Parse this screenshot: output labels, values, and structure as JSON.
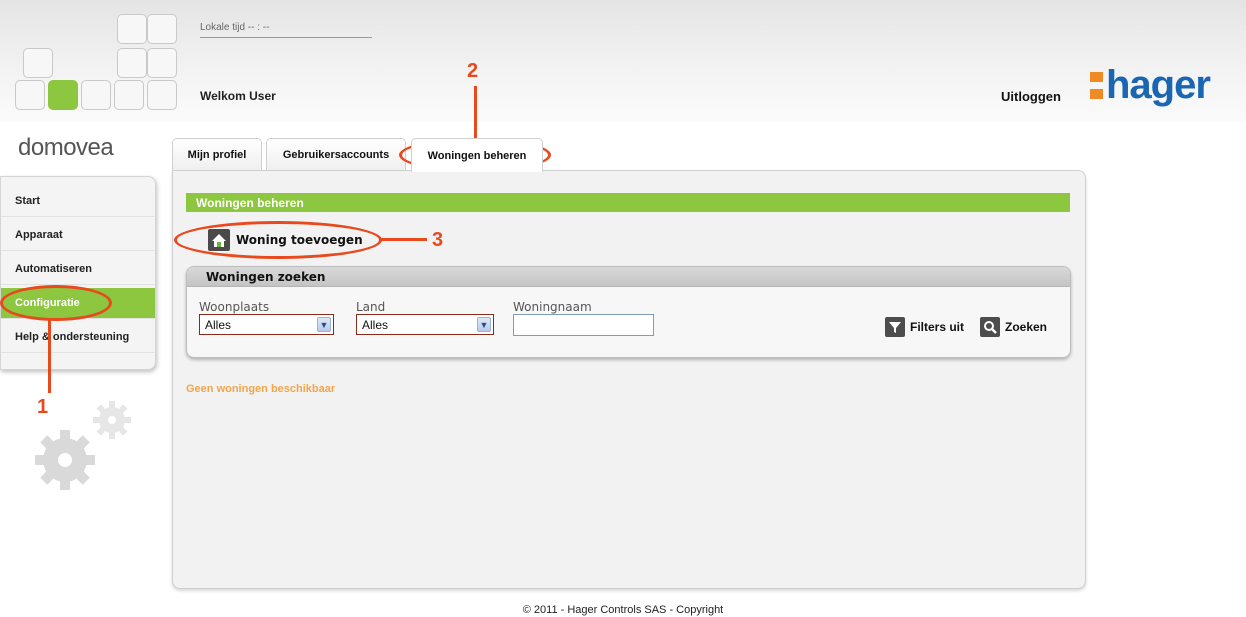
{
  "header": {
    "local_time": "Lokale tijd -- : --",
    "welcome": "Welkom User",
    "logout": "Uitloggen",
    "logo_text": "hager",
    "brand": "domovea"
  },
  "sidebar": {
    "items": [
      {
        "label": "Start"
      },
      {
        "label": "Apparaat"
      },
      {
        "label": "Automatiseren"
      },
      {
        "label": "Configuratie",
        "active": true
      },
      {
        "label": "Help & ondersteuning"
      }
    ]
  },
  "tabs": [
    {
      "label": "Mijn profiel"
    },
    {
      "label": "Gebruikersaccounts"
    },
    {
      "label": "Woningen beheren",
      "active": true
    }
  ],
  "main": {
    "section_title": "Woningen beheren",
    "add_button": "Woning toevoegen",
    "search": {
      "title": "Woningen zoeken",
      "woonplaats_label": "Woonplaats",
      "woonplaats_value": "Alles",
      "land_label": "Land",
      "land_value": "Alles",
      "woningnaam_label": "Woningnaam",
      "woningnaam_value": "",
      "filters_off": "Filters uit",
      "search_button": "Zoeken"
    },
    "empty_message": "Geen woningen beschikbaar"
  },
  "footer": "© 2011 - Hager Controls SAS - Copyright",
  "annotations": [
    "1",
    "2",
    "3"
  ],
  "colors": {
    "accent_green": "#8dc63f",
    "callout_red": "#e8491d",
    "hager_blue": "#1a66b3",
    "hager_orange": "#f08a24",
    "empty_message": "#f3a54a"
  },
  "icons": {
    "add_button": "house-icon",
    "filters_off": "filter-icon",
    "search_button": "magnifier-icon",
    "decoration": "gears-icon"
  }
}
